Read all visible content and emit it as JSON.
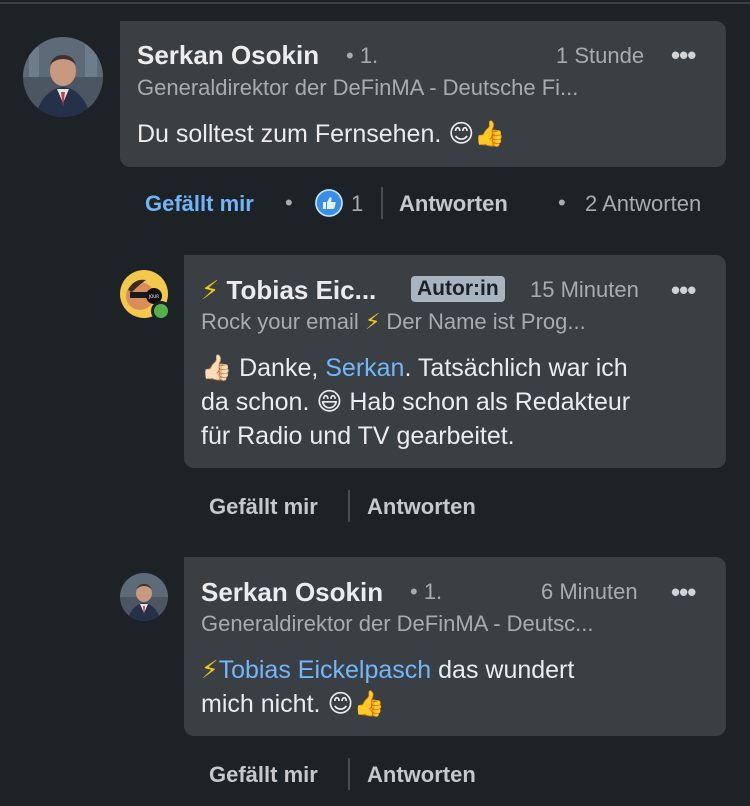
{
  "comments": [
    {
      "author": "Serkan Osokin",
      "degree": "• 1.",
      "time": "1 Stunde",
      "more": "•••",
      "headline": "Generaldirektor der DeFinMA - Deutsche Fi...",
      "text": "Du solltest zum Fernsehen.",
      "emoji": "😊👍",
      "like_label": "Gefällt mir",
      "like_count": "1",
      "reply_label": "Antworten",
      "replies_label": "2 Antworten"
    }
  ],
  "replies": [
    {
      "author": "Tobias Eic...",
      "bolt": "⚡",
      "badge": "Autor:in",
      "time": "15 Minuten",
      "more": "•••",
      "headline_a": "Rock your email",
      "headline_bolt": "⚡",
      "headline_b": "Der Name ist Prog...",
      "text_emoji_start": "👍🏻",
      "text_part1": " Danke, ",
      "mention": "Serkan",
      "text_part2": ". Tatsächlich war ich",
      "text_line2a": "da schon. ",
      "text_emoji_mid": "😄",
      "text_line2b": " Hab schon als Redakteur",
      "text_line3": "für Radio und TV gearbeitet.",
      "like_label": "Gefällt mir",
      "reply_label": "Antworten"
    },
    {
      "author": "Serkan Osokin",
      "degree": "• 1.",
      "time": "6 Minuten",
      "more": "•••",
      "headline": "Generaldirektor der DeFinMA - Deutsc...",
      "bolt": "⚡",
      "mention": "Tobias Eickelpasch",
      "text_part1": " das wundert",
      "text_line2": "mich nicht. ",
      "emoji": "😊👍",
      "like_label": "Gefällt mir",
      "reply_label": "Antworten"
    }
  ],
  "colors": {
    "background": "#1d2226",
    "bubble": "#3a3f44",
    "mention": "#71b7fb",
    "liked": "#70b5f9",
    "badge": "#a9b4c1"
  }
}
